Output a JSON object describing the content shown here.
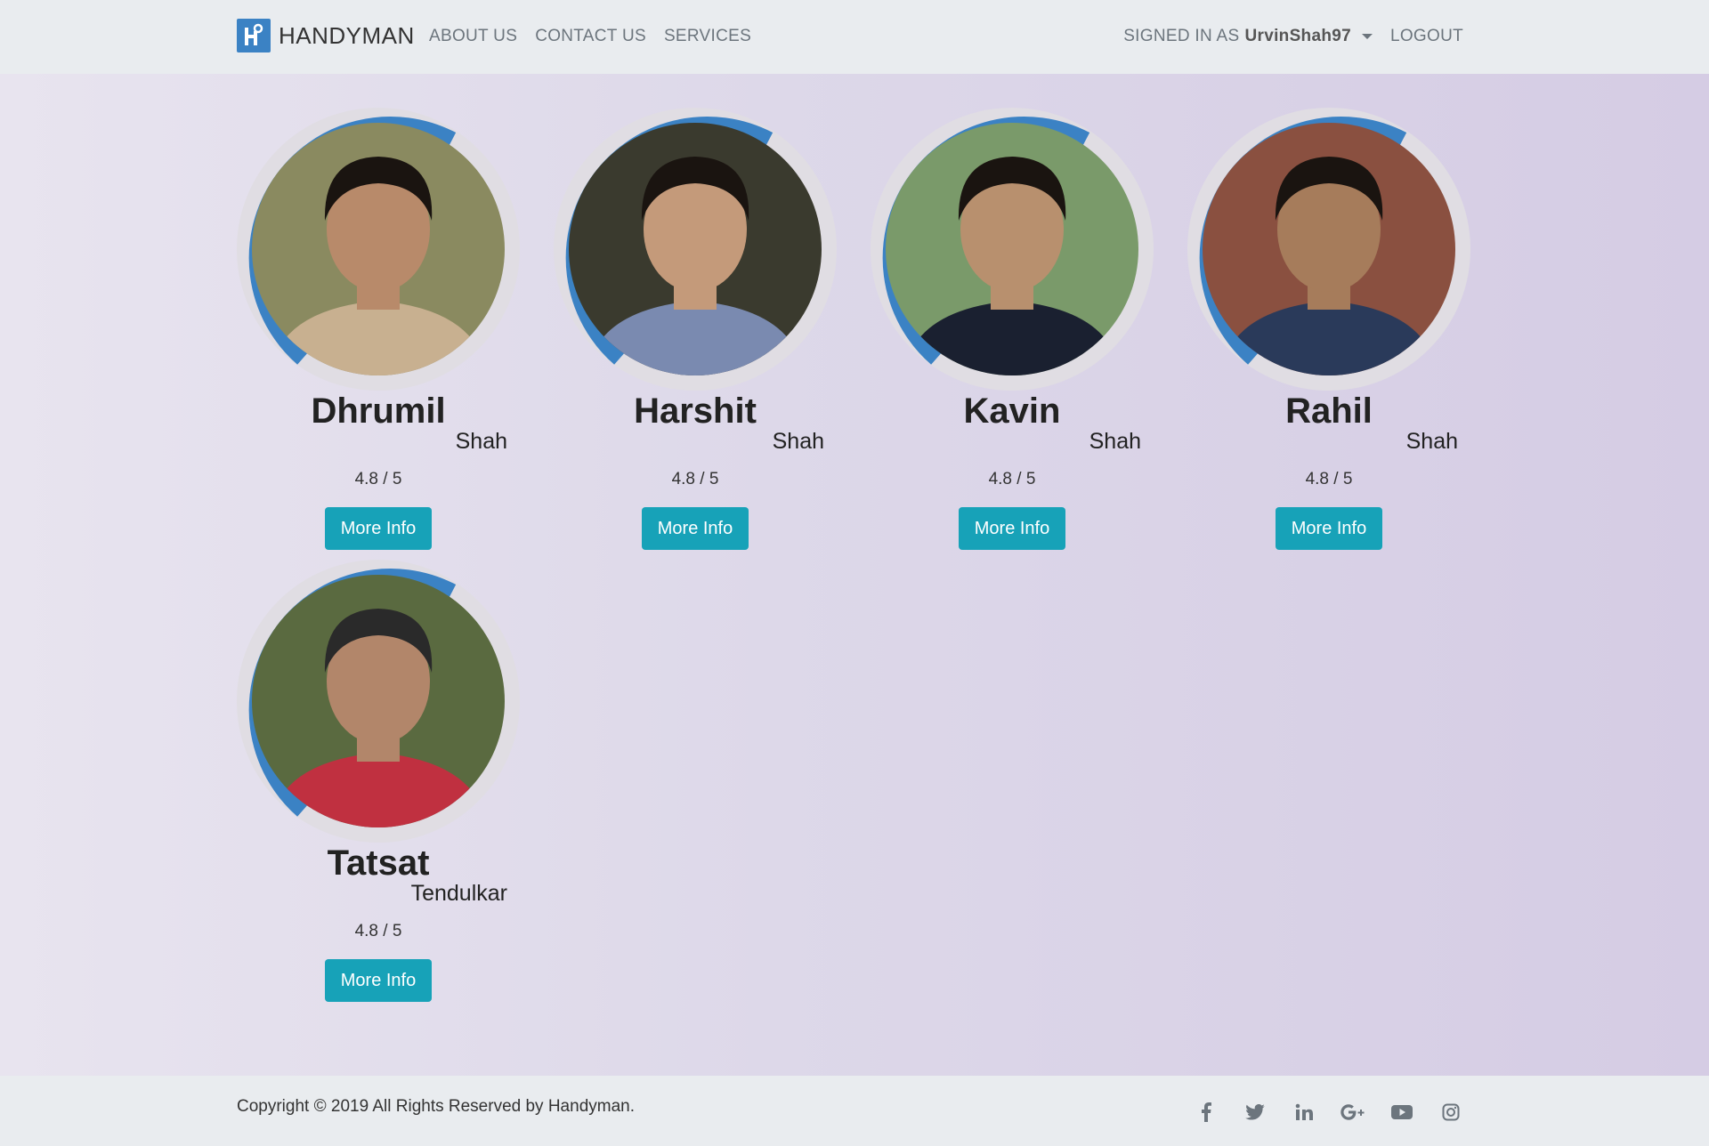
{
  "navbar": {
    "brand": "HANDYMAN",
    "links": [
      "ABOUT US",
      "CONTACT US",
      "SERVICES"
    ],
    "signed_in_prefix": "SIGNED IN AS",
    "username": "UrvinShah97",
    "logout": "LOGOUT"
  },
  "workers": [
    {
      "first": "Dhrumil",
      "last": "Shah",
      "rating": "4.8 / 5",
      "button": "More Info"
    },
    {
      "first": "Harshit",
      "last": "Shah",
      "rating": "4.8 / 5",
      "button": "More Info"
    },
    {
      "first": "Kavin",
      "last": "Shah",
      "rating": "4.8 / 5",
      "button": "More Info"
    },
    {
      "first": "Rahil",
      "last": "Shah",
      "rating": "4.8 / 5",
      "button": "More Info"
    },
    {
      "first": "Tatsat",
      "last": "Tendulkar",
      "rating": "4.8 / 5",
      "button": "More Info"
    }
  ],
  "footer": {
    "copyright": "Copyright © 2019 All Rights Reserved by Handyman.",
    "social_icons": [
      "facebook-icon",
      "twitter-icon",
      "linkedin-icon",
      "google-plus-icon",
      "youtube-icon",
      "instagram-icon"
    ]
  },
  "colors": {
    "accent_ring": "#3b82c4",
    "button": "#17a2b8",
    "navbar_bg": "#e9ecef"
  }
}
